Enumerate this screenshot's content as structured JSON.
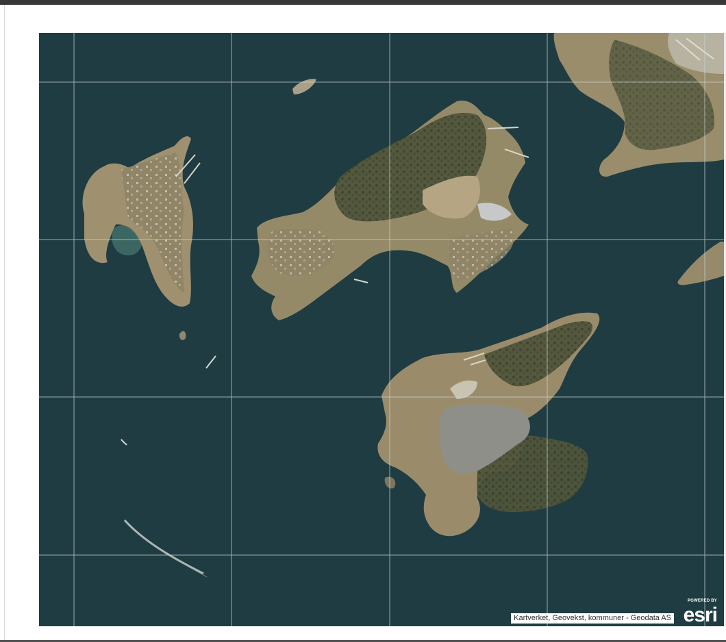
{
  "map": {
    "type": "satellite-imagery",
    "grid": true,
    "attribution": "Kartverket, Geovekst, kommuner - Geodata AS",
    "logo": {
      "powered_by": "POWERED BY",
      "name": "esri"
    }
  }
}
